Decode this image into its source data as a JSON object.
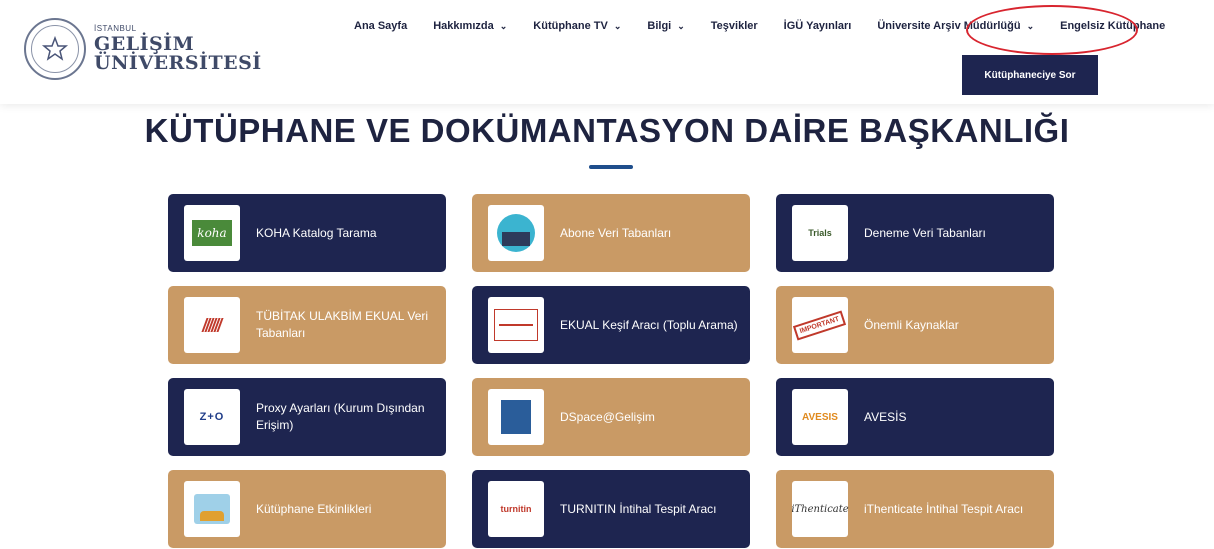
{
  "header": {
    "logo_small": "İSTANBUL",
    "logo_line1": "GELİŞİM",
    "logo_line2": "ÜNİVERSİTESİ",
    "nav": [
      {
        "label": "Ana Sayfa",
        "dropdown": false
      },
      {
        "label": "Hakkımızda",
        "dropdown": true
      },
      {
        "label": "Kütüphane TV",
        "dropdown": true
      },
      {
        "label": "Bilgi",
        "dropdown": true
      },
      {
        "label": "Teşvikler",
        "dropdown": false
      },
      {
        "label": "İGÜ Yayınları",
        "dropdown": false
      },
      {
        "label": "Üniversite Arşiv Müdürlüğü",
        "dropdown": true
      },
      {
        "label": "Engelsiz Kütüphane",
        "dropdown": false
      }
    ],
    "submenu_button": "Kütüphaneciye Sor"
  },
  "page_title": "KÜTÜPHANE VE DOKÜMANTASYON DAİRE BAŞKANLIĞI",
  "cards": [
    {
      "label": "KOHA Katalog Tarama",
      "style": "navy",
      "icon": "koha-icon",
      "icon_text": "koha"
    },
    {
      "label": "Abone Veri Tabanları",
      "style": "tan",
      "icon": "database-icon"
    },
    {
      "label": "Deneme Veri Tabanları",
      "style": "navy",
      "icon": "trials-icon",
      "icon_text": "Trials"
    },
    {
      "label": "TÜBİTAK ULAKBİM EKUAL Veri Tabanları",
      "style": "tan",
      "icon": "ulakbim-icon"
    },
    {
      "label": "EKUAL Keşif Aracı (Toplu Arama)",
      "style": "navy",
      "icon": "ekual-icon"
    },
    {
      "label": "Önemli Kaynaklar",
      "style": "tan",
      "icon": "important-icon",
      "icon_text": "IMPORTANT"
    },
    {
      "label": "Proxy Ayarları (Kurum Dışından Erişim)",
      "style": "navy",
      "icon": "proxy-icon",
      "icon_text": "Z+O"
    },
    {
      "label": "DSpace@Gelişim",
      "style": "tan",
      "icon": "dspace-icon"
    },
    {
      "label": "AVESİS",
      "style": "navy",
      "icon": "avesis-icon",
      "icon_text": "AVESIS"
    },
    {
      "label": "Kütüphane Etkinlikleri",
      "style": "tan",
      "icon": "events-icon"
    },
    {
      "label": "TURNITIN İntihal Tespit Aracı",
      "style": "navy",
      "icon": "turnitin-icon",
      "icon_text": "turnitin"
    },
    {
      "label": "iThenticate İntihal Tespit Aracı",
      "style": "tan",
      "icon": "ithenticate-icon",
      "icon_text": "iThenticate"
    }
  ],
  "colors": {
    "navy": "#1e2550",
    "tan": "#c99a65",
    "highlight_ring": "#d8252f",
    "title_underline": "#1f4e8c"
  }
}
